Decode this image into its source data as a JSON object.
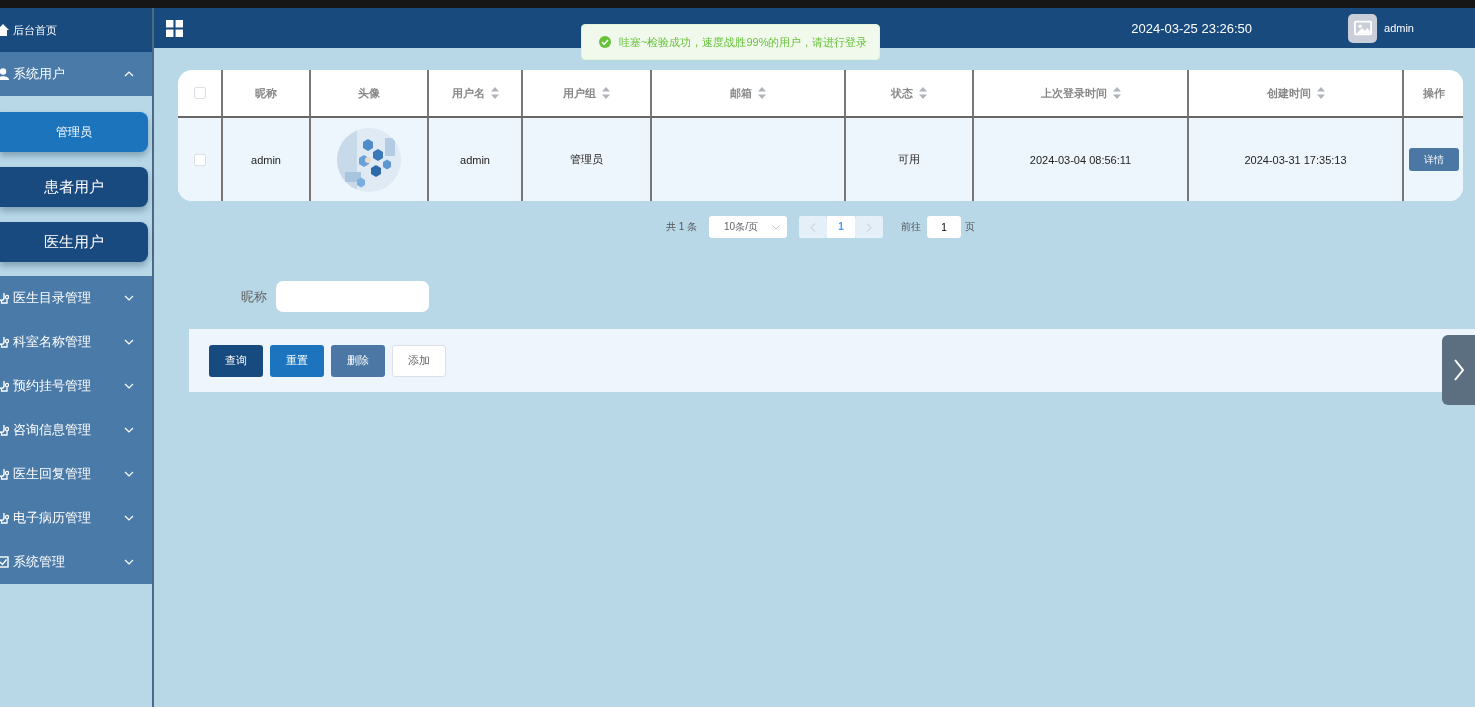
{
  "sidebar": {
    "items": [
      {
        "label": "后台首页",
        "kind": "link"
      },
      {
        "label": "系统用户",
        "kind": "group",
        "expanded": true,
        "children": [
          {
            "label": "管理员",
            "selected": true
          },
          {
            "label": "患者用户",
            "selected": false
          },
          {
            "label": "医生用户",
            "selected": false
          }
        ]
      },
      {
        "label": "医生目录管理",
        "kind": "group",
        "expanded": false
      },
      {
        "label": "科室名称管理",
        "kind": "group",
        "expanded": false
      },
      {
        "label": "预约挂号管理",
        "kind": "group",
        "expanded": false
      },
      {
        "label": "咨询信息管理",
        "kind": "group",
        "expanded": false
      },
      {
        "label": "医生回复管理",
        "kind": "group",
        "expanded": false
      },
      {
        "label": "电子病历管理",
        "kind": "group",
        "expanded": false
      },
      {
        "label": "系统管理",
        "kind": "group",
        "expanded": false
      }
    ]
  },
  "header": {
    "datetime": "2024-03-25 23:26:50",
    "user": "admin"
  },
  "toast": {
    "message": "哇塞~检验成功，速度战胜99%的用户，请进行登录"
  },
  "table": {
    "select_all": false,
    "columns": [
      {
        "label": "昵称",
        "sortable": false
      },
      {
        "label": "头像",
        "sortable": false
      },
      {
        "label": "用户名",
        "sortable": true
      },
      {
        "label": "用户组",
        "sortable": true
      },
      {
        "label": "邮箱",
        "sortable": true
      },
      {
        "label": "状态",
        "sortable": true
      },
      {
        "label": "上次登录时间",
        "sortable": true
      },
      {
        "label": "创建时间",
        "sortable": true
      },
      {
        "label": "操作",
        "sortable": false
      }
    ],
    "rows": [
      {
        "checked": false,
        "nickname": "admin",
        "username": "admin",
        "group": "管理员",
        "status": "可用",
        "last_login": "2024-03-04 08:56:11",
        "created": "2024-03-31 17:35:13",
        "action": "详情"
      }
    ]
  },
  "pagination": {
    "total": "共 1 条",
    "page_size": "10条/页",
    "pages": [
      {
        "label": "1",
        "selected": true
      }
    ],
    "goto_label": "前往",
    "goto_value": "1",
    "goto_unit": "页"
  },
  "search": {
    "label": "昵称"
  },
  "buttons": [
    {
      "label": "查询",
      "kind": "primary"
    },
    {
      "label": "重置",
      "kind": "info"
    },
    {
      "label": "删除",
      "kind": "danger"
    },
    {
      "label": "添加",
      "kind": "plain"
    }
  ]
}
